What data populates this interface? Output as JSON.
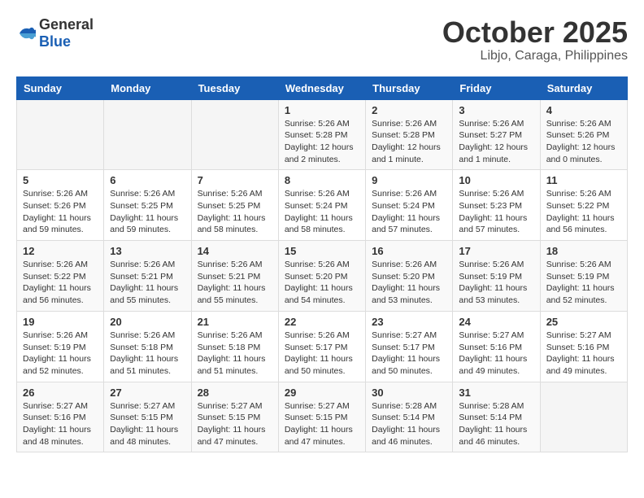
{
  "logo": {
    "general": "General",
    "blue": "Blue"
  },
  "header": {
    "month": "October 2025",
    "location": "Libjo, Caraga, Philippines"
  },
  "weekdays": [
    "Sunday",
    "Monday",
    "Tuesday",
    "Wednesday",
    "Thursday",
    "Friday",
    "Saturday"
  ],
  "weeks": [
    [
      {
        "day": "",
        "info": ""
      },
      {
        "day": "",
        "info": ""
      },
      {
        "day": "",
        "info": ""
      },
      {
        "day": "1",
        "info": "Sunrise: 5:26 AM\nSunset: 5:28 PM\nDaylight: 12 hours\nand 2 minutes."
      },
      {
        "day": "2",
        "info": "Sunrise: 5:26 AM\nSunset: 5:28 PM\nDaylight: 12 hours\nand 1 minute."
      },
      {
        "day": "3",
        "info": "Sunrise: 5:26 AM\nSunset: 5:27 PM\nDaylight: 12 hours\nand 1 minute."
      },
      {
        "day": "4",
        "info": "Sunrise: 5:26 AM\nSunset: 5:26 PM\nDaylight: 12 hours\nand 0 minutes."
      }
    ],
    [
      {
        "day": "5",
        "info": "Sunrise: 5:26 AM\nSunset: 5:26 PM\nDaylight: 11 hours\nand 59 minutes."
      },
      {
        "day": "6",
        "info": "Sunrise: 5:26 AM\nSunset: 5:25 PM\nDaylight: 11 hours\nand 59 minutes."
      },
      {
        "day": "7",
        "info": "Sunrise: 5:26 AM\nSunset: 5:25 PM\nDaylight: 11 hours\nand 58 minutes."
      },
      {
        "day": "8",
        "info": "Sunrise: 5:26 AM\nSunset: 5:24 PM\nDaylight: 11 hours\nand 58 minutes."
      },
      {
        "day": "9",
        "info": "Sunrise: 5:26 AM\nSunset: 5:24 PM\nDaylight: 11 hours\nand 57 minutes."
      },
      {
        "day": "10",
        "info": "Sunrise: 5:26 AM\nSunset: 5:23 PM\nDaylight: 11 hours\nand 57 minutes."
      },
      {
        "day": "11",
        "info": "Sunrise: 5:26 AM\nSunset: 5:22 PM\nDaylight: 11 hours\nand 56 minutes."
      }
    ],
    [
      {
        "day": "12",
        "info": "Sunrise: 5:26 AM\nSunset: 5:22 PM\nDaylight: 11 hours\nand 56 minutes."
      },
      {
        "day": "13",
        "info": "Sunrise: 5:26 AM\nSunset: 5:21 PM\nDaylight: 11 hours\nand 55 minutes."
      },
      {
        "day": "14",
        "info": "Sunrise: 5:26 AM\nSunset: 5:21 PM\nDaylight: 11 hours\nand 55 minutes."
      },
      {
        "day": "15",
        "info": "Sunrise: 5:26 AM\nSunset: 5:20 PM\nDaylight: 11 hours\nand 54 minutes."
      },
      {
        "day": "16",
        "info": "Sunrise: 5:26 AM\nSunset: 5:20 PM\nDaylight: 11 hours\nand 53 minutes."
      },
      {
        "day": "17",
        "info": "Sunrise: 5:26 AM\nSunset: 5:19 PM\nDaylight: 11 hours\nand 53 minutes."
      },
      {
        "day": "18",
        "info": "Sunrise: 5:26 AM\nSunset: 5:19 PM\nDaylight: 11 hours\nand 52 minutes."
      }
    ],
    [
      {
        "day": "19",
        "info": "Sunrise: 5:26 AM\nSunset: 5:19 PM\nDaylight: 11 hours\nand 52 minutes."
      },
      {
        "day": "20",
        "info": "Sunrise: 5:26 AM\nSunset: 5:18 PM\nDaylight: 11 hours\nand 51 minutes."
      },
      {
        "day": "21",
        "info": "Sunrise: 5:26 AM\nSunset: 5:18 PM\nDaylight: 11 hours\nand 51 minutes."
      },
      {
        "day": "22",
        "info": "Sunrise: 5:26 AM\nSunset: 5:17 PM\nDaylight: 11 hours\nand 50 minutes."
      },
      {
        "day": "23",
        "info": "Sunrise: 5:27 AM\nSunset: 5:17 PM\nDaylight: 11 hours\nand 50 minutes."
      },
      {
        "day": "24",
        "info": "Sunrise: 5:27 AM\nSunset: 5:16 PM\nDaylight: 11 hours\nand 49 minutes."
      },
      {
        "day": "25",
        "info": "Sunrise: 5:27 AM\nSunset: 5:16 PM\nDaylight: 11 hours\nand 49 minutes."
      }
    ],
    [
      {
        "day": "26",
        "info": "Sunrise: 5:27 AM\nSunset: 5:16 PM\nDaylight: 11 hours\nand 48 minutes."
      },
      {
        "day": "27",
        "info": "Sunrise: 5:27 AM\nSunset: 5:15 PM\nDaylight: 11 hours\nand 48 minutes."
      },
      {
        "day": "28",
        "info": "Sunrise: 5:27 AM\nSunset: 5:15 PM\nDaylight: 11 hours\nand 47 minutes."
      },
      {
        "day": "29",
        "info": "Sunrise: 5:27 AM\nSunset: 5:15 PM\nDaylight: 11 hours\nand 47 minutes."
      },
      {
        "day": "30",
        "info": "Sunrise: 5:28 AM\nSunset: 5:14 PM\nDaylight: 11 hours\nand 46 minutes."
      },
      {
        "day": "31",
        "info": "Sunrise: 5:28 AM\nSunset: 5:14 PM\nDaylight: 11 hours\nand 46 minutes."
      },
      {
        "day": "",
        "info": ""
      }
    ]
  ]
}
